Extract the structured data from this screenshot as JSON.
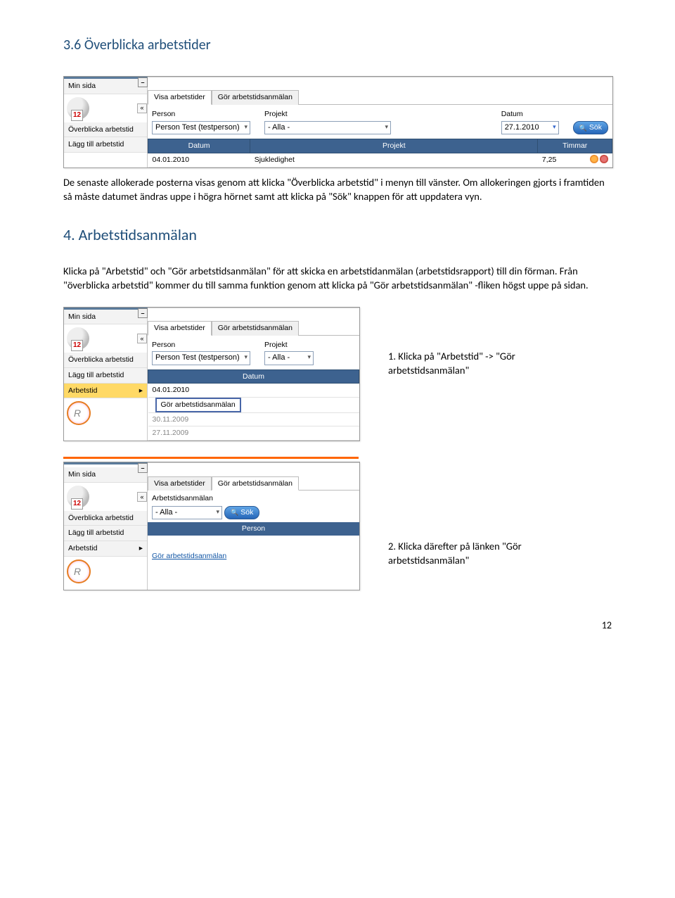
{
  "headings": {
    "h36": "3.6 Överblicka arbetstider",
    "h4": "4. Arbetstidsanmälan"
  },
  "paragraphs": {
    "p1": "De senaste allokerade posterna visas genom att klicka \"Överblicka arbetstid\" i menyn till vänster. Om allokeringen gjorts i framtiden så måste datumet ändras uppe i högra hörnet samt att klicka på \"Sök\" knappen för att uppdatera vyn.",
    "p2": "Klicka på \"Arbetstid\" och \"Gör arbetstidsanmälan\" för att skicka en arbetstidanmälan (arbetstidsrapport) till din förman. Från \"överblicka arbetstid\" kommer du till samma funktion genom att klicka på \"Gör arbetstidsanmälan\" -fliken högst uppe på sidan.",
    "note1": "1. Klicka på \"Arbetstid\" -> \"Gör arbetstidsanmälan\"",
    "note2": "2. Klicka därefter på länken \"Gör  arbetstidsanmälan\""
  },
  "ui": {
    "sidebar": {
      "minsida": "Min sida",
      "overblicka": "Överblicka arbetstid",
      "laggtill": "Lägg till arbetstid",
      "arbetstid": "Arbetstid",
      "caret": "▸"
    },
    "tabs": {
      "visa": "Visa arbetstider",
      "gor": "Gör arbetstidsanmälan"
    },
    "labels": {
      "person": "Person",
      "projekt": "Projekt",
      "datum": "Datum",
      "arbetstidsanmalan": "Arbetstidsanmälan"
    },
    "fields": {
      "person_value": "Person Test (testperson)",
      "projekt_value": "- Alla -",
      "datum_value": "27.1.2010",
      "alla": "- Alla -"
    },
    "buttons": {
      "sok": "Sök"
    },
    "table1": {
      "headers": {
        "datum": "Datum",
        "projekt": "Projekt",
        "timmar": "Timmar"
      },
      "row": {
        "datum": "04.01.2010",
        "projekt": "Sjukledighet",
        "timmar": "7,25"
      }
    },
    "table2": {
      "header": "Datum",
      "rows": [
        "04.01.2010",
        "30.11.2009",
        "27.11.2009"
      ],
      "submenu": "Gör arbetstidsanmälan"
    },
    "table3": {
      "header": "Person",
      "link": "Gör arbetstidsanmälan"
    }
  },
  "pagenum": "12"
}
